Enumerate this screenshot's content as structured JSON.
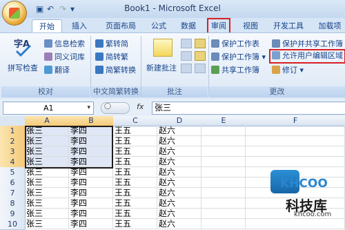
{
  "window": {
    "title": "Book1 - Microsoft Excel"
  },
  "qat": {
    "save_icon": "save-icon",
    "undo_icon": "undo-icon",
    "redo_icon": "redo-icon"
  },
  "tabs": [
    {
      "label": "开始"
    },
    {
      "label": "插入"
    },
    {
      "label": "页面布局"
    },
    {
      "label": "公式"
    },
    {
      "label": "数据"
    },
    {
      "label": "审阅"
    },
    {
      "label": "视图"
    },
    {
      "label": "开发工具"
    },
    {
      "label": "加载项"
    }
  ],
  "ribbon": {
    "proofing": {
      "spell_check": "拼写检查",
      "research": "信息检索",
      "thesaurus": "同义词库",
      "translate": "翻译",
      "title": "校对"
    },
    "chinese": {
      "to_simplified": "繁转简",
      "to_traditional": "简转繁",
      "convert": "简繁转换",
      "title": "中文简繁转换"
    },
    "comments": {
      "new_comment": "新建批注",
      "title": "批注"
    },
    "changes": {
      "protect_sheet": "保护工作表",
      "protect_workbook": "保护工作簿",
      "share_workbook": "共享工作簿",
      "protect_share_workbook": "保护并共享工作簿",
      "allow_edit_ranges": "允许用户编辑区域",
      "track_changes": "修订",
      "title": "更改"
    }
  },
  "formula_bar": {
    "name_box": "A1",
    "fx": "fx",
    "value": "张三"
  },
  "sheet": {
    "columns": [
      "A",
      "B",
      "C",
      "D",
      "E",
      "F"
    ],
    "rows": [
      {
        "n": "1",
        "a": "张三",
        "b": "李四",
        "c": "王五",
        "d": "赵六"
      },
      {
        "n": "2",
        "a": "张三",
        "b": "李四",
        "c": "王五",
        "d": "赵六"
      },
      {
        "n": "3",
        "a": "张三",
        "b": "李四",
        "c": "王五",
        "d": "赵六"
      },
      {
        "n": "4",
        "a": "张三",
        "b": "李四",
        "c": "王五",
        "d": "赵六"
      },
      {
        "n": "5",
        "a": "张三",
        "b": "李四",
        "c": "王五",
        "d": "赵六"
      },
      {
        "n": "6",
        "a": "张三",
        "b": "李四",
        "c": "王五",
        "d": "赵六"
      },
      {
        "n": "7",
        "a": "张三",
        "b": "李四",
        "c": "王五",
        "d": "赵六"
      },
      {
        "n": "8",
        "a": "张三",
        "b": "李四",
        "c": "王五",
        "d": "赵六"
      },
      {
        "n": "9",
        "a": "张三",
        "b": "李四",
        "c": "王五",
        "d": "赵六"
      },
      {
        "n": "10",
        "a": "张三",
        "b": "李四",
        "c": "王五",
        "d": "赵六"
      }
    ]
  },
  "watermark": {
    "brand": "KHCOO",
    "cn": "科技库",
    "url": "khcoo.com"
  },
  "colors": {
    "highlight": "#d81f26",
    "selection": "#dfe6f5"
  }
}
